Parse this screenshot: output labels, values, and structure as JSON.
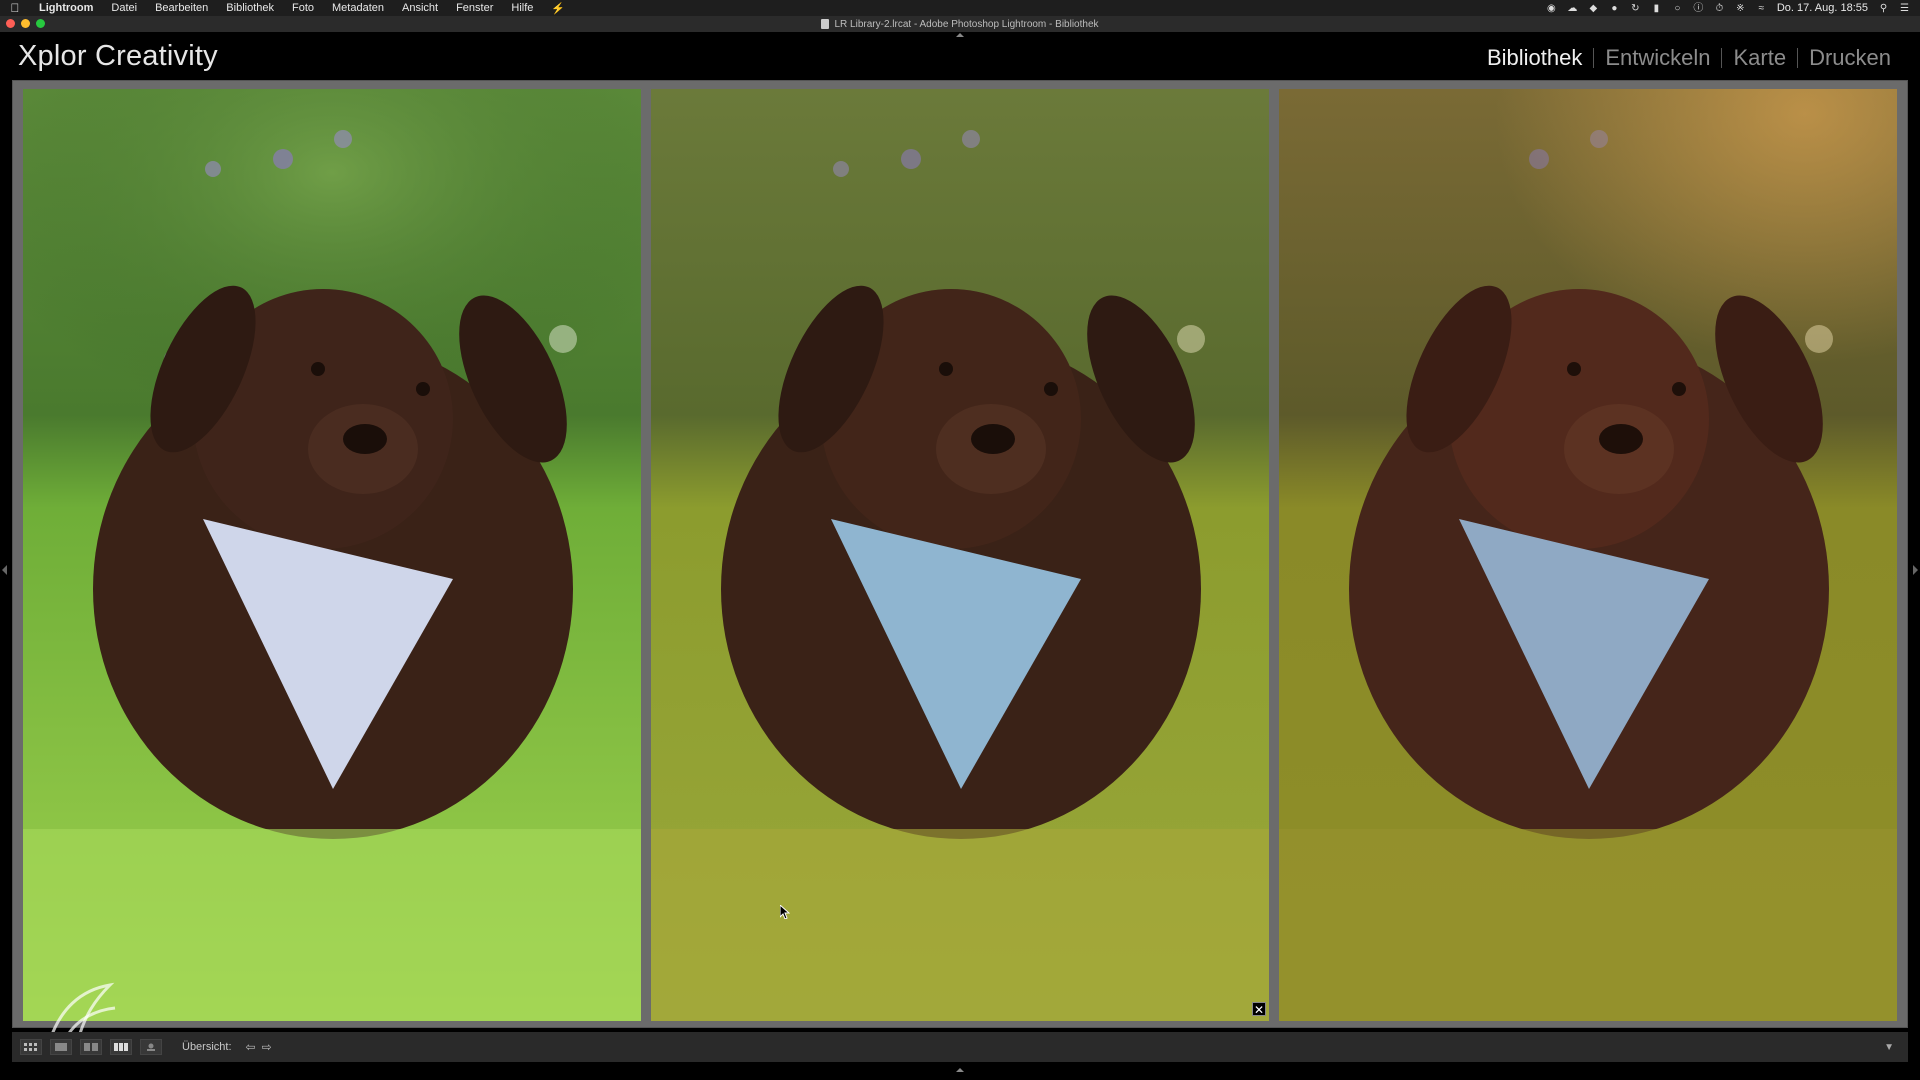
{
  "menubar": {
    "app_name": "Lightroom",
    "items": [
      "Datei",
      "Bearbeiten",
      "Bibliothek",
      "Foto",
      "Metadaten",
      "Ansicht",
      "Fenster",
      "Hilfe"
    ],
    "clock": "Do. 17. Aug. 18:55"
  },
  "window": {
    "title": "LR Library-2.lrcat - Adobe Photoshop Lightroom - Bibliothek"
  },
  "identity_plate": "Xplor Creativity",
  "modules": [
    {
      "label": "Bibliothek",
      "active": true
    },
    {
      "label": "Entwickeln",
      "active": false
    },
    {
      "label": "Karte",
      "active": false
    },
    {
      "label": "Drucken",
      "active": false
    }
  ],
  "photos": [
    {
      "variant": "original",
      "tone": "cool-green",
      "selected": true
    },
    {
      "variant": "edit-1",
      "tone": "warm-yellow-green",
      "selected": false
    },
    {
      "variant": "edit-2",
      "tone": "warm-golden",
      "selected": false
    }
  ],
  "toolbar": {
    "overview_label": "Übersicht:",
    "view_buttons": [
      "grid-view",
      "loupe-view",
      "compare-view",
      "survey-view",
      "people-view"
    ]
  },
  "colors": {
    "background": "#6b6b6b",
    "toolbar": "#2a2a2a",
    "selection_border": "#f2f2f2"
  }
}
